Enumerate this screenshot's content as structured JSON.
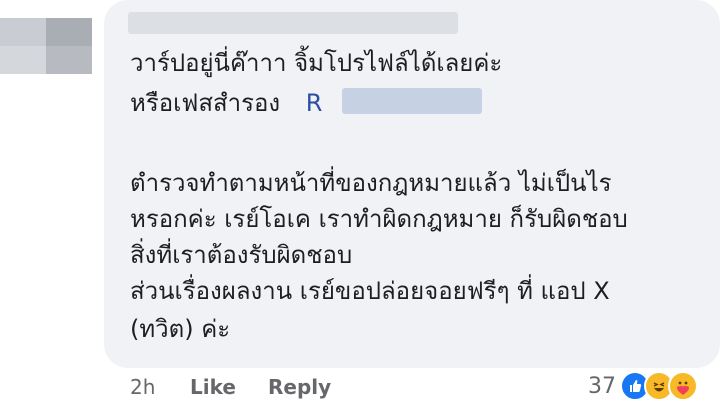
{
  "comment": {
    "lines": [
      "วาร์ปอยู่นี่ค๊าาา จิ้มโปรไฟล์ได้เลยค่ะ",
      "หรือเฟสสำรอง",
      "ตำรวจทำตามหน้าที่ของกฎหมายแล้ว ไม่เป็นไร",
      "หรอกค่ะ เรย์โอเค เราทำผิดกฎหมาย ก็รับผิดชอบ",
      "สิ่งที่เราต้องรับผิดชอบ",
      "ส่วนเรื่องผลงาน เรย์ขอปล่อยจอยฟรีๆ ที่ แอป X",
      "(ทวิต) ค่ะ"
    ],
    "mention_initial": "R"
  },
  "meta": {
    "time": "2h",
    "like_label": "Like",
    "reply_label": "Reply"
  },
  "reactions": {
    "count": "37",
    "icons": [
      "like-icon",
      "haha-icon",
      "care-icon"
    ]
  },
  "colors": {
    "bubble": "#f0f2f5",
    "text": "#1c1e21",
    "meta": "#65676b",
    "like_blue": "#1877f2",
    "mention": "#2c4fa3"
  }
}
